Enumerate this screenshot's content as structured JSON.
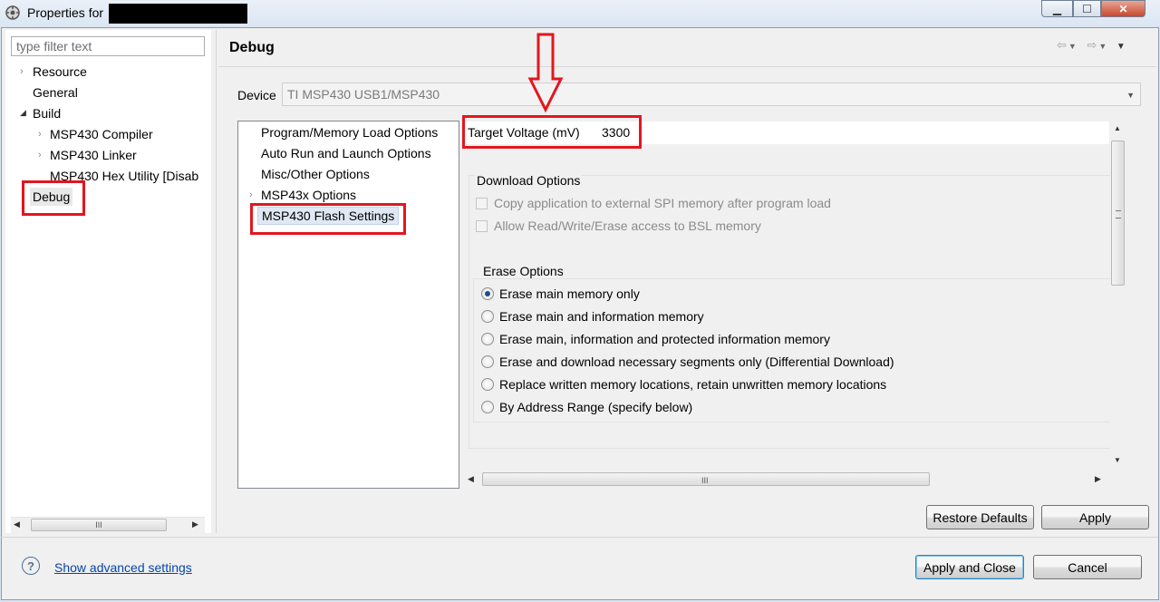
{
  "window": {
    "title": "Properties for",
    "controls": {
      "minimize": "▁",
      "maximize": "☐",
      "close": "✕"
    }
  },
  "left_panel": {
    "filter_placeholder": "type filter text",
    "tree": [
      {
        "label": "Resource",
        "twisty": "›"
      },
      {
        "label": "General",
        "twisty": ""
      },
      {
        "label": "Build",
        "twisty": "◢"
      },
      {
        "label": "MSP430 Compiler",
        "twisty": "›"
      },
      {
        "label": "MSP430 Linker",
        "twisty": "›"
      },
      {
        "label": "MSP430 Hex Utility  [Disab",
        "twisty": ""
      },
      {
        "label": "Debug",
        "twisty": "",
        "selected": true
      }
    ],
    "hscroll_grip": "III"
  },
  "page": {
    "title": "Debug",
    "nav_icons": [
      "back-arrow-icon",
      "dropdown-icon",
      "forward-arrow-icon",
      "dropdown-icon",
      "menu-icon"
    ]
  },
  "device": {
    "label": "Device",
    "value": "TI MSP430 USB1/MSP430"
  },
  "categories": [
    {
      "label": "Program/Memory Load Options",
      "twisty": ""
    },
    {
      "label": "Auto Run and Launch Options",
      "twisty": ""
    },
    {
      "label": "Misc/Other Options",
      "twisty": ""
    },
    {
      "label": "MSP43x Options",
      "twisty": "›"
    },
    {
      "label": "MSP430 Flash Settings",
      "twisty": "",
      "selected": true
    }
  ],
  "settings": {
    "target_voltage_label": "Target Voltage (mV)",
    "target_voltage_value": "3300",
    "download_options": {
      "title": "Download Options",
      "checkboxes": [
        {
          "label": "Copy application to external SPI memory after program load",
          "checked": false,
          "enabled": false
        },
        {
          "label": "Allow Read/Write/Erase access to BSL memory",
          "checked": false,
          "enabled": false
        }
      ]
    },
    "erase_options": {
      "title": "Erase Options",
      "radios": [
        {
          "label": "Erase main memory only",
          "selected": true
        },
        {
          "label": "Erase main and information memory",
          "selected": false
        },
        {
          "label": "Erase main, information and protected information memory",
          "selected": false
        },
        {
          "label": "Erase and download necessary segments only (Differential Download)",
          "selected": false
        },
        {
          "label": "Replace written memory locations, retain unwritten memory locations",
          "selected": false
        },
        {
          "label": "By Address Range (specify below)",
          "selected": false
        }
      ]
    }
  },
  "buttons": {
    "restore_defaults": "Restore Defaults",
    "apply": "Apply",
    "apply_and_close": "Apply and Close",
    "cancel": "Cancel"
  },
  "footer": {
    "help_icon": "?",
    "advanced_link": "Show advanced settings"
  },
  "annotation": {
    "arrow_color": "#e3161e"
  }
}
